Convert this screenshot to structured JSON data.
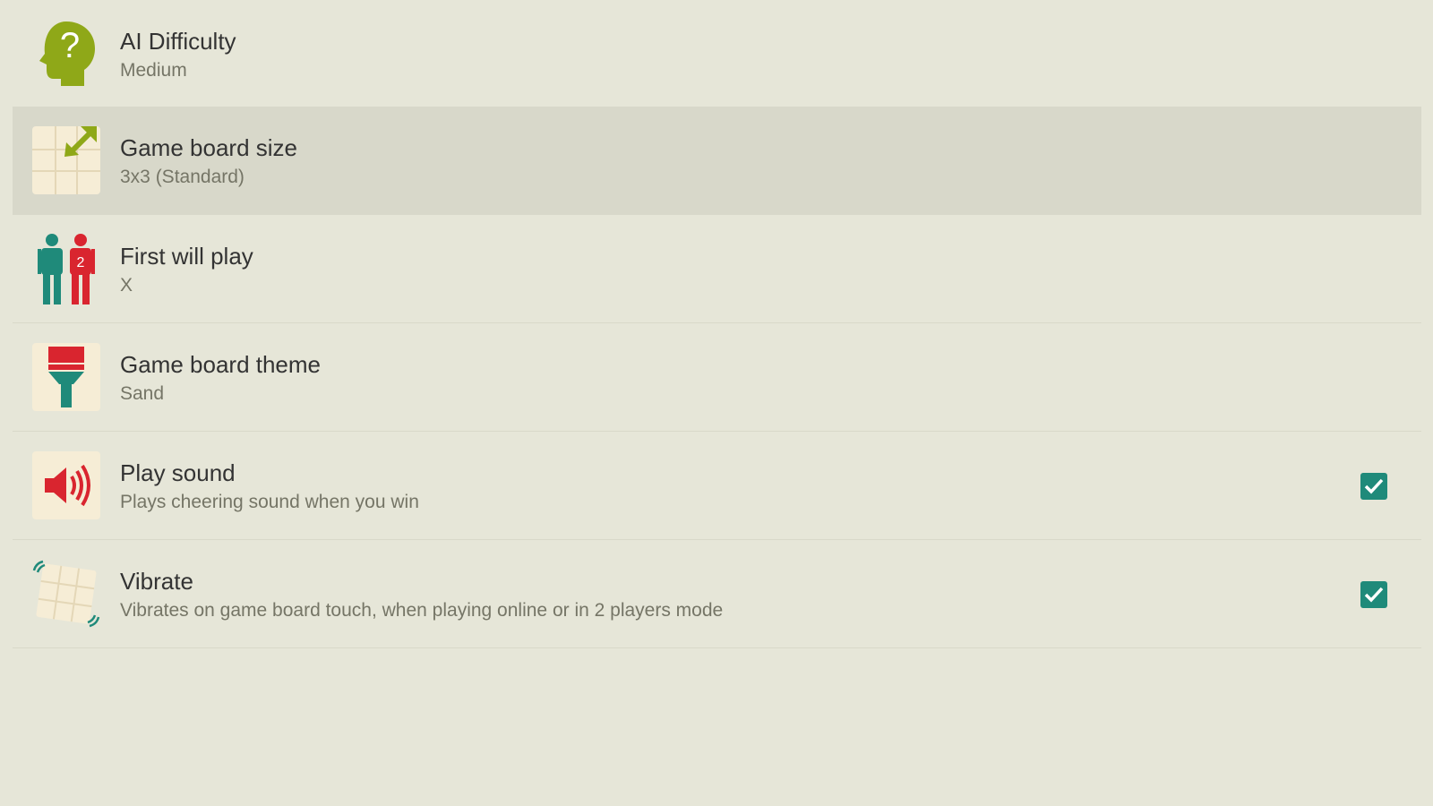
{
  "settings": [
    {
      "id": "ai-difficulty",
      "title": "AI Difficulty",
      "summary": "Medium",
      "icon": "head-question-icon"
    },
    {
      "id": "board-size",
      "title": "Game board size",
      "summary": "3x3 (Standard)",
      "icon": "board-resize-icon"
    },
    {
      "id": "first-player",
      "title": "First will play",
      "summary": "X",
      "icon": "two-players-icon"
    },
    {
      "id": "board-theme",
      "title": "Game board theme",
      "summary": "Sand",
      "icon": "paint-brush-icon"
    },
    {
      "id": "play-sound",
      "title": "Play sound",
      "summary": "Plays cheering sound when you win",
      "icon": "speaker-icon",
      "checked": true
    },
    {
      "id": "vibrate",
      "title": "Vibrate",
      "summary": "Vibrates on game board touch, when playing online or in 2 players mode",
      "icon": "vibrate-board-icon",
      "checked": true
    }
  ],
  "colors": {
    "background": "#e6e6d8",
    "highlight": "#d8d8ca",
    "accent": "#1f8a7a",
    "olive": "#8fa818",
    "red": "#d9252f"
  }
}
